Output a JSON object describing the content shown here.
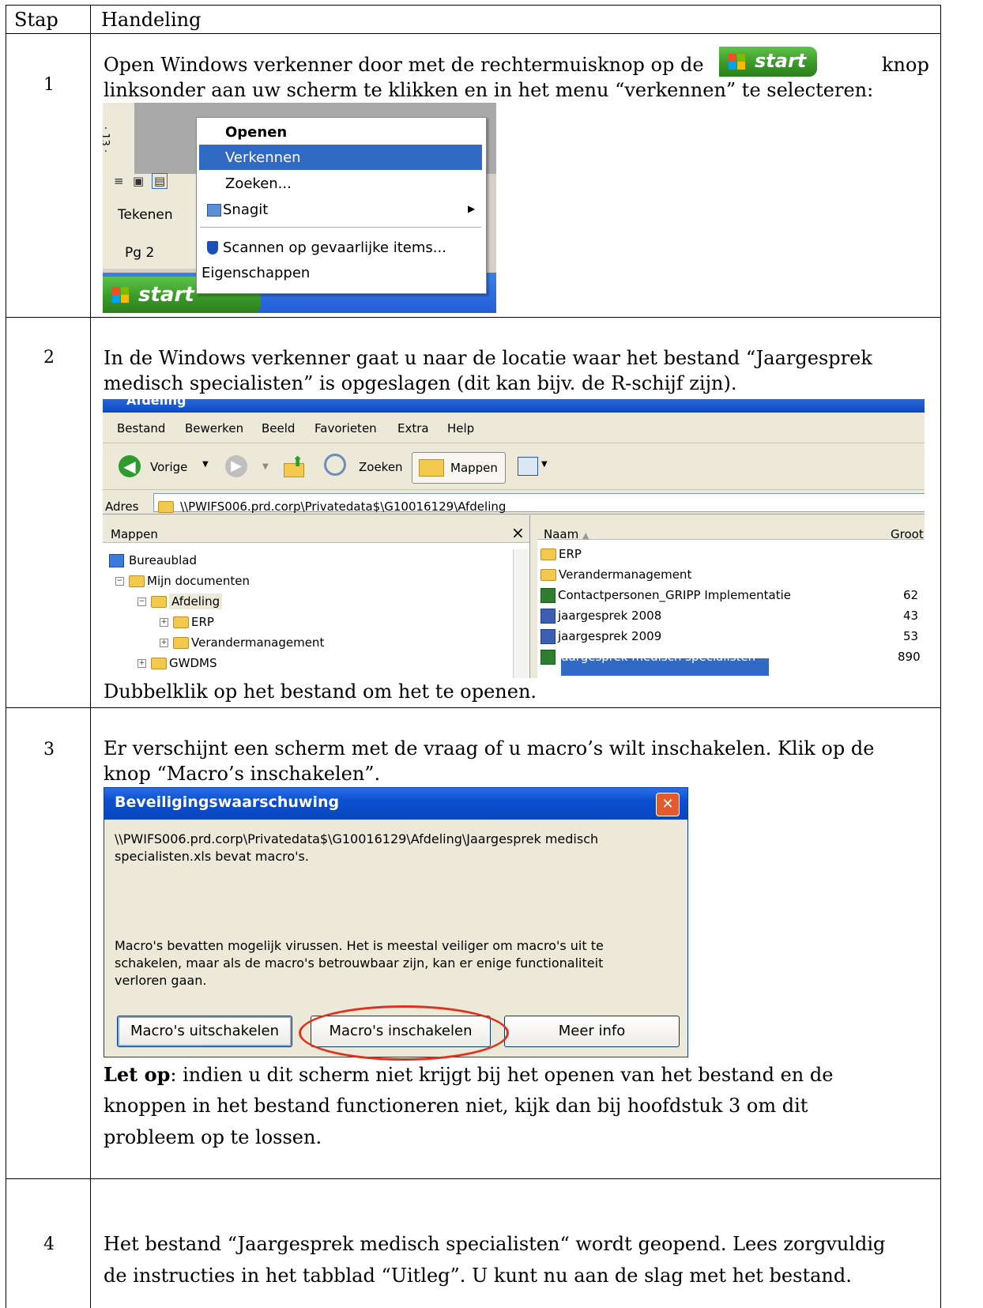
{
  "table": {
    "headers": [
      "Stap",
      "Handeling"
    ],
    "steps": [
      {
        "number": "1",
        "lines": [
          "Open Windows verkenner door met de rechtermuisknop op de",
          "knop",
          "linksonder aan uw scherm te klikken en in het menu “verkennen” te selecteren:"
        ]
      },
      {
        "number": "2",
        "lines": [
          "In de Windows verkenner gaat u naar de locatie waar het bestand “Jaargesprek",
          "medisch specialisten” is opgeslagen (dit kan bijv. de R-schijf zijn).",
          "Dubbelklik op het bestand om het te openen."
        ]
      },
      {
        "number": "3",
        "lines": [
          "Er verschijnt een scherm met de vraag of u macro’s wilt inschakelen. Klik op de",
          "knop “Macro’s inschakelen”."
        ],
        "note_bold": "Let op",
        "note_lines": [
          ": indien u dit scherm niet krijgt bij het openen van het bestand en de",
          "knoppen in het bestand functioneren niet, kijk dan bij hoofdstuk 3 om dit",
          "probleem op te lossen."
        ]
      },
      {
        "number": "4",
        "lines": [
          "Het bestand “Jaargesprek medisch specialisten“ wordt geopend. Lees zorgvuldig",
          "de instructies in het tabblad “Uitleg”. U kunt nu aan de slag met het bestand."
        ]
      }
    ]
  },
  "start_button": {
    "label": "start",
    "colors": {
      "green": "#3a9a28",
      "text": "#ffffff"
    }
  },
  "context_menu": {
    "side": {
      "ruler": "· 13 ·",
      "tekenen": "Tekenen",
      "page": "Pg 2"
    },
    "items": [
      "Openen",
      "Verkennen",
      "Zoeken...",
      "Snagit",
      "Scannen op gevaarlijke items...",
      "Eigenschappen"
    ],
    "selected_color": "#316ac5",
    "taskbar_label": "start"
  },
  "explorer": {
    "title": "Afdeling",
    "menu": [
      "Bestand",
      "Bewerken",
      "Beeld",
      "Favorieten",
      "Extra",
      "Help"
    ],
    "toolbar": {
      "back": "Vorige",
      "search": "Zoeken",
      "folders": "Mappen"
    },
    "address_label": "Adres",
    "address": "\\\\PWIFS006.prd.corp\\Privatedata$\\G10016129\\Afdeling",
    "folders_pane_title": "Mappen",
    "close": "×",
    "tree": [
      {
        "label": "Bureaublad",
        "level": 0
      },
      {
        "label": "Mijn documenten",
        "level": 0
      },
      {
        "label": "Afdeling",
        "level": 1
      },
      {
        "label": "ERP",
        "level": 2
      },
      {
        "label": "Verandermanagement",
        "level": 2
      },
      {
        "label": "GWDMS",
        "level": 1
      }
    ],
    "columns": {
      "name": "Naam",
      "size": "Groot"
    },
    "files": [
      {
        "name": "ERP",
        "size": ""
      },
      {
        "name": "Verandermanagement",
        "size": ""
      },
      {
        "name": "Contactpersonen_GRIPP Implementatie",
        "size": "62"
      },
      {
        "name": "jaargesprek 2008",
        "size": "43"
      },
      {
        "name": "jaargesprek 2009",
        "size": "53"
      },
      {
        "name": "Jaargesprek medisch specialisten",
        "size": "890"
      }
    ]
  },
  "dialog": {
    "title": "Beveiligingswaarschuwing",
    "close": "✕",
    "message_lines": [
      "\\\\PWIFS006.prd.corp\\Privatedata$\\G10016129\\Afdeling\\Jaargesprek medisch",
      "specialisten.xls bevat macro's."
    ],
    "warning_lines": [
      "Macro's bevatten mogelijk virussen. Het is meestal veiliger om macro's uit te",
      "schakelen, maar als de macro's betrouwbaar zijn, kan er enige functionaliteit",
      "verloren gaan."
    ],
    "buttons": [
      "Macro's uitschakelen",
      "Macro's inschakelen",
      "Meer info"
    ],
    "highlight_color": "#e0301e",
    "title_color": "#0a58d8"
  }
}
